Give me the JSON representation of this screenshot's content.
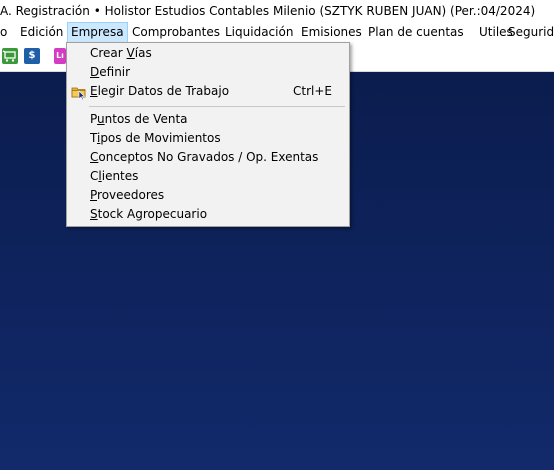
{
  "window": {
    "title": "A. Registración • Holistor Estudios Contables Milenio  (SZTYK RUBEN JUAN) (Per.:04/2024)"
  },
  "menubar": {
    "items": [
      "o",
      "Edición",
      "Empresa",
      "Comprobantes",
      "Liquidación",
      "Emisiones",
      "Plan de cuentas",
      "Utiles",
      "Segurida"
    ]
  },
  "toolbar": {
    "buttons": [
      {
        "icon": "cart-icon",
        "color": "#3a9a3a"
      },
      {
        "icon": "dollar-icon",
        "color": "#1f5fa8"
      },
      {
        "icon": "pink-app-icon",
        "color": "#d43cc4"
      }
    ],
    "dollar_glyph": "$",
    "pink_glyph": "Lı"
  },
  "dropdown": {
    "items": [
      {
        "label": "Crear Vías",
        "accel": "V"
      },
      {
        "label": "Definir",
        "accel": "D"
      },
      {
        "label": "Elegir Datos de Trabajo",
        "accel": "E",
        "shortcut": "Ctrl+E",
        "icon": "folder-icon"
      },
      {
        "label": "Puntos de Venta",
        "accel": "u"
      },
      {
        "label": "Tipos de Movimientos",
        "accel": "i"
      },
      {
        "label": "Conceptos No Gravados / Op. Exentas",
        "accel": "C"
      },
      {
        "label": "Clientes",
        "accel": "l"
      },
      {
        "label": "Proveedores",
        "accel": "P"
      },
      {
        "label": "Stock Agropecuario",
        "accel": "S"
      }
    ]
  },
  "colors": {
    "workspace_top": "#0b1c4e",
    "workspace_bottom": "#122a6b",
    "menu_highlight": "#cce8ff"
  }
}
